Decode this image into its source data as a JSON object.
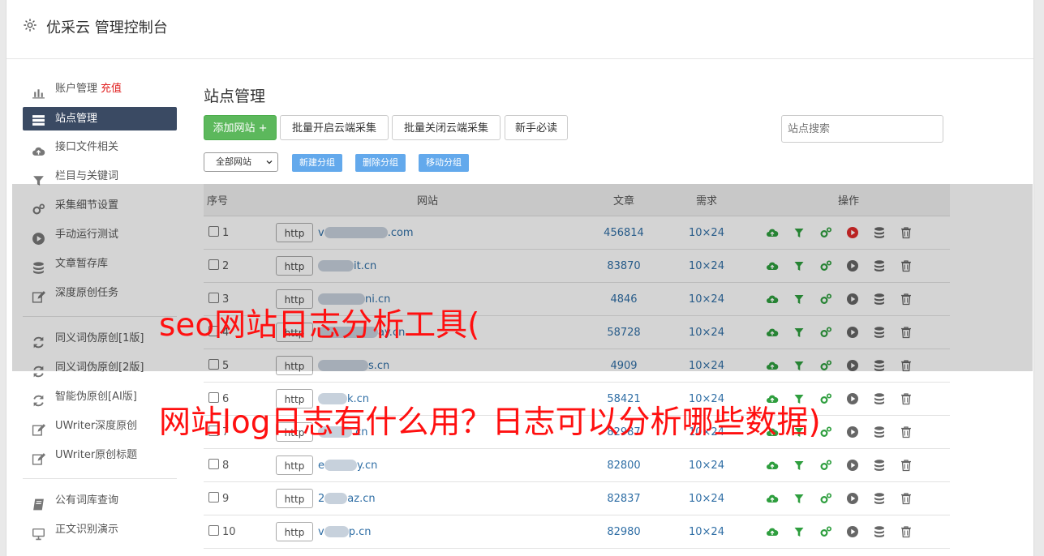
{
  "app": {
    "title": "优采云 管理控制台"
  },
  "sidebar": {
    "items": [
      {
        "label": "账户管理",
        "extra": "充值",
        "icon": "bar-chart-icon"
      },
      {
        "label": "站点管理",
        "icon": "server-list-icon",
        "active": true
      },
      {
        "label": "接口文件相关",
        "icon": "cloud-upload-icon"
      },
      {
        "label": "栏目与关键词",
        "icon": "filter-icon"
      },
      {
        "label": "采集细节设置",
        "icon": "cogs-icon"
      },
      {
        "label": "手动运行测试",
        "icon": "play-circle-icon"
      },
      {
        "label": "文章暂存库",
        "icon": "database-icon"
      },
      {
        "label": "深度原创任务",
        "icon": "edit-icon"
      }
    ],
    "items2": [
      {
        "label": "同义词伪原创[1版]",
        "icon": "refresh-icon"
      },
      {
        "label": "同义词伪原创[2版]",
        "icon": "refresh-icon"
      },
      {
        "label": "智能伪原创[AI版]",
        "icon": "refresh-icon"
      },
      {
        "label": "UWriter深度原创",
        "icon": "edit-icon"
      },
      {
        "label": "UWriter原创标题",
        "icon": "edit-icon"
      }
    ],
    "items3": [
      {
        "label": "公有词库查询",
        "icon": "book-icon"
      },
      {
        "label": "正文识别演示",
        "icon": "monitor-icon"
      }
    ]
  },
  "main": {
    "title": "站点管理",
    "buttons": {
      "add_site": "添加网站 +",
      "batch_open": "批量开启云端采集",
      "batch_close": "批量关闭云端采集",
      "newbie": "新手必读"
    },
    "search_placeholder": "站点搜索",
    "group_select": "全部网站",
    "group_buttons": {
      "new": "新建分组",
      "delete": "删除分组",
      "move": "移动分组"
    },
    "table": {
      "headers": {
        "no": "序号",
        "site": "网站",
        "articles": "文章",
        "demand": "需求",
        "ops": "操作"
      },
      "http_label": "http",
      "rows": [
        {
          "no": "1",
          "prefix": "v",
          "suffix": ".com",
          "articles": "456814",
          "demand": "10×24",
          "running": true
        },
        {
          "no": "2",
          "prefix": "",
          "suffix": "it.cn",
          "articles": "83870",
          "demand": "10×24",
          "running": false
        },
        {
          "no": "3",
          "prefix": "",
          "suffix": "ni.cn",
          "articles": "4846",
          "demand": "10×24",
          "running": false
        },
        {
          "no": "4",
          "prefix": "",
          "suffix": "ay.cn",
          "articles": "58728",
          "demand": "10×24",
          "running": false
        },
        {
          "no": "5",
          "prefix": "",
          "suffix": "s.cn",
          "articles": "4909",
          "demand": "10×24",
          "running": false
        },
        {
          "no": "6",
          "prefix": "",
          "suffix": "k.cn",
          "articles": "58421",
          "demand": "10×24",
          "running": false
        },
        {
          "no": "7",
          "prefix": "",
          "suffix": ".cn",
          "articles": "82987",
          "demand": "10×24",
          "running": false
        },
        {
          "no": "8",
          "prefix": "e",
          "suffix": "y.cn",
          "articles": "82800",
          "demand": "10×24",
          "running": false
        },
        {
          "no": "9",
          "prefix": "2",
          "suffix": "az.cn",
          "articles": "82837",
          "demand": "10×24",
          "running": false
        },
        {
          "no": "10",
          "prefix": "v",
          "suffix": "p.cn",
          "articles": "82980",
          "demand": "10×24",
          "running": false
        }
      ]
    }
  },
  "watermark": {
    "line1": "seo网站日志分析工具(",
    "line2": "网站log日志有什么用？日志可以分析哪些数据)"
  },
  "colors": {
    "accent_green": "#5cb85c",
    "nav_active": "#3a4a63",
    "link_blue": "#2f6ea5",
    "watermark_red": "#ff1010"
  }
}
